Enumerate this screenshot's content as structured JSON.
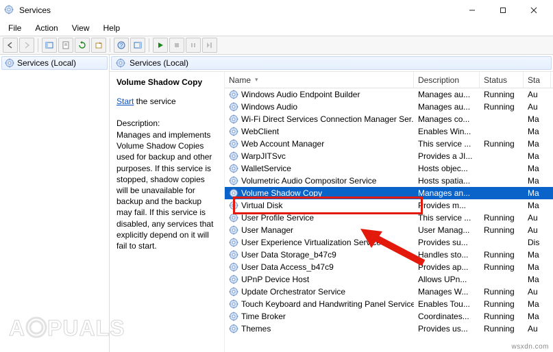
{
  "window": {
    "title": "Services"
  },
  "menu": {
    "file": "File",
    "action": "Action",
    "view": "View",
    "help": "Help"
  },
  "tree": {
    "root": "Services (Local)"
  },
  "panel_header": "Services (Local)",
  "details": {
    "service_name": "Volume Shadow Copy",
    "start_link": "Start",
    "start_suffix": " the service",
    "description_label": "Description:",
    "description_text": "Manages and implements Volume Shadow Copies used for backup and other purposes. If this service is stopped, shadow copies will be unavailable for backup and the backup may fail. If this service is disabled, any services that explicitly depend on it will fail to start."
  },
  "columns": {
    "name": "Name",
    "description": "Description",
    "status": "Status",
    "startup": "Sta"
  },
  "services": [
    {
      "name": "Windows Audio Endpoint Builder",
      "desc": "Manages au...",
      "status": "Running",
      "startup": "Au"
    },
    {
      "name": "Windows Audio",
      "desc": "Manages au...",
      "status": "Running",
      "startup": "Au"
    },
    {
      "name": "Wi-Fi Direct Services Connection Manager Ser...",
      "desc": "Manages co...",
      "status": "",
      "startup": "Ma"
    },
    {
      "name": "WebClient",
      "desc": "Enables Win...",
      "status": "",
      "startup": "Ma"
    },
    {
      "name": "Web Account Manager",
      "desc": "This service ...",
      "status": "Running",
      "startup": "Ma"
    },
    {
      "name": "WarpJITSvc",
      "desc": "Provides a JI...",
      "status": "",
      "startup": "Ma"
    },
    {
      "name": "WalletService",
      "desc": "Hosts objec...",
      "status": "",
      "startup": "Ma"
    },
    {
      "name": "Volumetric Audio Compositor Service",
      "desc": "Hosts spatia...",
      "status": "",
      "startup": "Ma"
    },
    {
      "name": "Volume Shadow Copy",
      "desc": "Manages an...",
      "status": "",
      "startup": "Ma",
      "selected": true
    },
    {
      "name": "Virtual Disk",
      "desc": "Provides m...",
      "status": "",
      "startup": "Ma"
    },
    {
      "name": "User Profile Service",
      "desc": "This service ...",
      "status": "Running",
      "startup": "Au"
    },
    {
      "name": "User Manager",
      "desc": "User Manag...",
      "status": "Running",
      "startup": "Au"
    },
    {
      "name": "User Experience Virtualization Service",
      "desc": "Provides su...",
      "status": "",
      "startup": "Dis"
    },
    {
      "name": "User Data Storage_b47c9",
      "desc": "Handles sto...",
      "status": "Running",
      "startup": "Ma"
    },
    {
      "name": "User Data Access_b47c9",
      "desc": "Provides ap...",
      "status": "Running",
      "startup": "Ma"
    },
    {
      "name": "UPnP Device Host",
      "desc": "Allows UPn...",
      "status": "",
      "startup": "Ma"
    },
    {
      "name": "Update Orchestrator Service",
      "desc": "Manages W...",
      "status": "Running",
      "startup": "Au"
    },
    {
      "name": "Touch Keyboard and Handwriting Panel Service",
      "desc": "Enables Tou...",
      "status": "Running",
      "startup": "Ma"
    },
    {
      "name": "Time Broker",
      "desc": "Coordinates...",
      "status": "Running",
      "startup": "Ma"
    },
    {
      "name": "Themes",
      "desc": "Provides us...",
      "status": "Running",
      "startup": "Au"
    }
  ],
  "watermark_a": "APPUALS",
  "watermark_b": "wsxdn.com"
}
